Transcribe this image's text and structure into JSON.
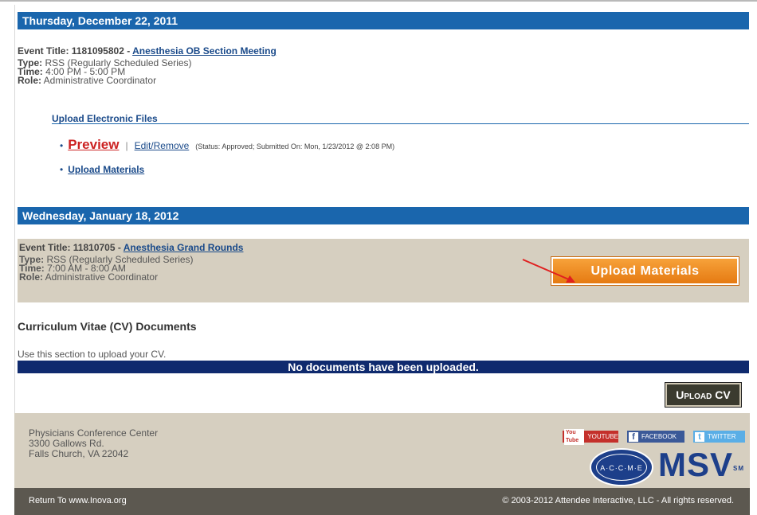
{
  "sections": [
    {
      "date": "Thursday, December 22, 2011",
      "event_label": "Event Title: 1181095802 -",
      "event_title": "Anesthesia OB Section Meeting",
      "type_label": "Type:",
      "type_value": "RSS (Regularly Scheduled Series)",
      "time_label": "Time:",
      "time_value": "4:00 PM - 5:00 PM",
      "role_label": "Role:",
      "role_value": "Administrative Coordinator",
      "upload_heading": "Upload Electronic Files",
      "preview_label": "Preview",
      "separator": "|",
      "edit_label": "Edit/Remove",
      "status_text": "(Status: Approved; Submitted On: Mon, 1/23/2012 @ 2:08 PM)",
      "upload_materials_link": "Upload Materials"
    },
    {
      "date": "Wednesday, January 18, 2012",
      "event_label": "Event Title: 11810705 -",
      "event_title": "Anesthesia Grand Rounds",
      "type_label": "Type:",
      "type_value": "RSS (Regularly Scheduled Series)",
      "time_label": "Time:",
      "time_value": "7:00 AM - 8:00 AM",
      "role_label": "Role:",
      "role_value": "Administrative Coordinator",
      "upload_button": "Upload Materials"
    }
  ],
  "cv": {
    "title": "Curriculum Vitae (CV) Documents",
    "description": "Use this section to upload your CV.",
    "empty_message": "No documents have been uploaded.",
    "upload_button": "Upload CV"
  },
  "footer": {
    "address_line1": "Physicians Conference Center",
    "address_line2": "3300 Gallows Rd.",
    "address_line3": "Falls Church, VA 22042",
    "youtube_logo": "You Tube",
    "youtube_label": "YOUTUBE",
    "facebook_logo": "f",
    "facebook_label": "FACEBOOK",
    "twitter_logo": "t",
    "twitter_label": "TWITTER",
    "acme_logo": "A·C·C·M·E",
    "msv_logo": "MSV",
    "msv_mark": "SM",
    "return_link": "Return To www.Inova.org",
    "copyright": "© 2003-2012 Attendee Interactive, LLC - All rights reserved."
  },
  "colors": {
    "date_bar": "#1a66ad",
    "event_highlight": "#d6cfc0",
    "upload_button": "#f08a22",
    "no_docs_bar": "#0f2a6e",
    "bottom_bar": "#5c5850",
    "annotation_arrow": "#e02020"
  }
}
